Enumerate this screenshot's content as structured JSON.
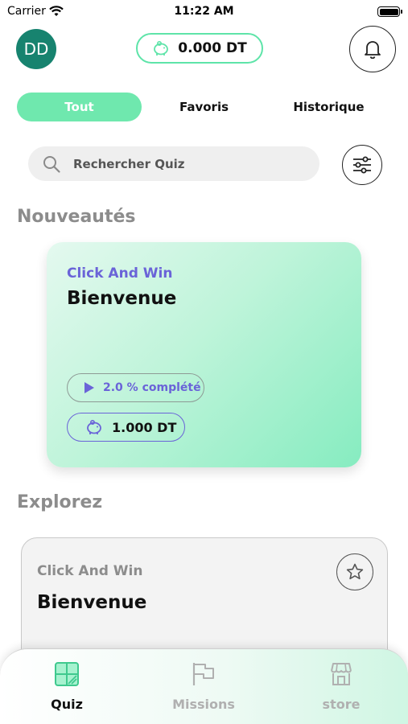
{
  "status_bar": {
    "carrier": "Carrier",
    "time": "11:22 AM"
  },
  "header": {
    "avatar_initials": "DD",
    "balance": "0.000 DT"
  },
  "tabs": [
    {
      "label": "Tout",
      "active": true
    },
    {
      "label": "Favoris",
      "active": false
    },
    {
      "label": "Historique",
      "active": false
    }
  ],
  "search": {
    "placeholder": "Rechercher Quiz"
  },
  "sections": {
    "new": "Nouveautés",
    "explore": "Explorez"
  },
  "featured_card": {
    "subtitle": "Click And Win",
    "title": "Bienvenue",
    "progress_text": "2.0 % complété",
    "progress_percent": 2.0,
    "reward": "1.000 DT"
  },
  "explore_card": {
    "subtitle": "Click And Win",
    "title": "Bienvenue"
  },
  "bottom_nav": [
    {
      "label": "Quiz",
      "icon": "quiz-icon",
      "active": true
    },
    {
      "label": "Missions",
      "icon": "flag-icon",
      "active": false
    },
    {
      "label": "store",
      "icon": "store-icon",
      "active": false
    }
  ],
  "colors": {
    "accent_green": "#6fe8ae",
    "accent_purple": "#6a63d8",
    "avatar_bg": "#17836f"
  }
}
